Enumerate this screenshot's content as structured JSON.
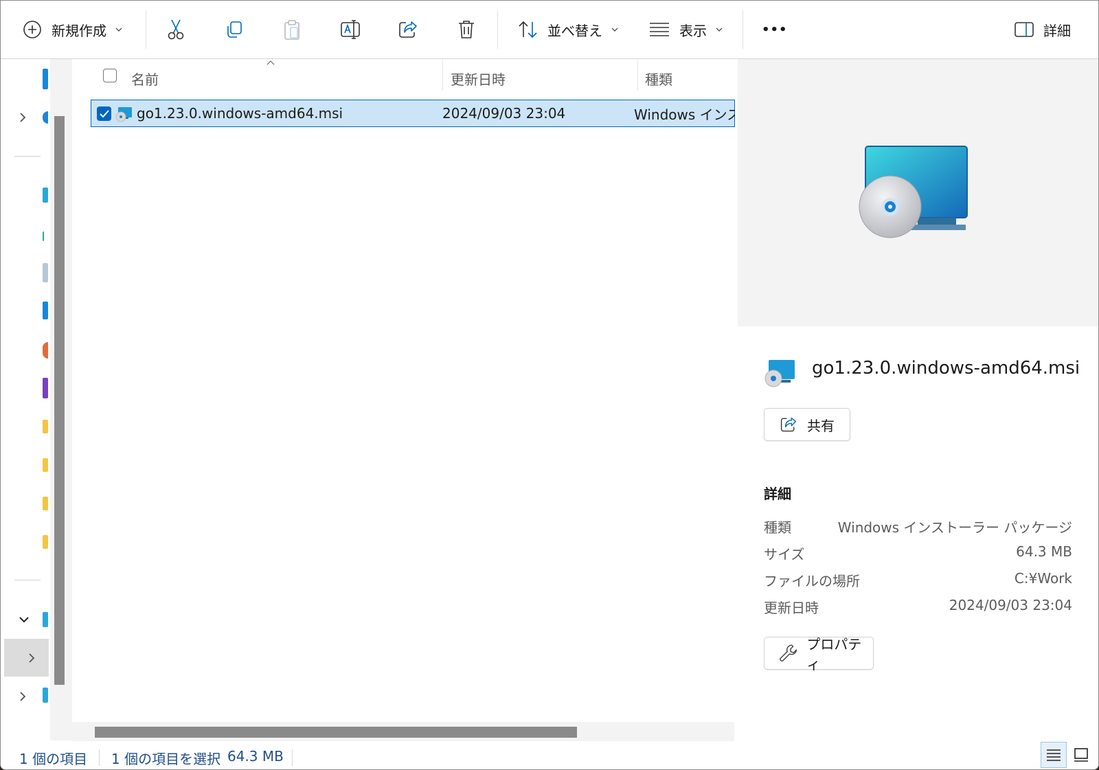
{
  "toolbar": {
    "new_label": "新規作成",
    "sort_label": "並べ替え",
    "view_label": "表示",
    "more_label": "•••",
    "details_label": "詳細"
  },
  "columns": {
    "name": "名前",
    "modified": "更新日時",
    "type": "種類"
  },
  "files": [
    {
      "name": "go1.23.0.windows-amd64.msi",
      "modified": "2024/09/03 23:04",
      "type": "Windows インストーラー パッケージ",
      "selected": true
    }
  ],
  "details_pane": {
    "filename": "go1.23.0.windows-amd64.msi",
    "share_label": "共有",
    "section_label": "詳細",
    "props": [
      {
        "key": "種類",
        "value": "Windows インストーラー パッケージ"
      },
      {
        "key": "サイズ",
        "value": "64.3 MB"
      },
      {
        "key": "ファイルの場所",
        "value": "C:¥Work"
      },
      {
        "key": "更新日時",
        "value": "2024/09/03 23:04"
      }
    ],
    "properties_label": "プロパティ"
  },
  "status": {
    "item_count": "1 個の項目",
    "selected": "1 個の項目を選択",
    "selected_size": "64.3 MB"
  },
  "colors": {
    "accent": "#0067c0",
    "selection_bg": "#cce4f7"
  }
}
